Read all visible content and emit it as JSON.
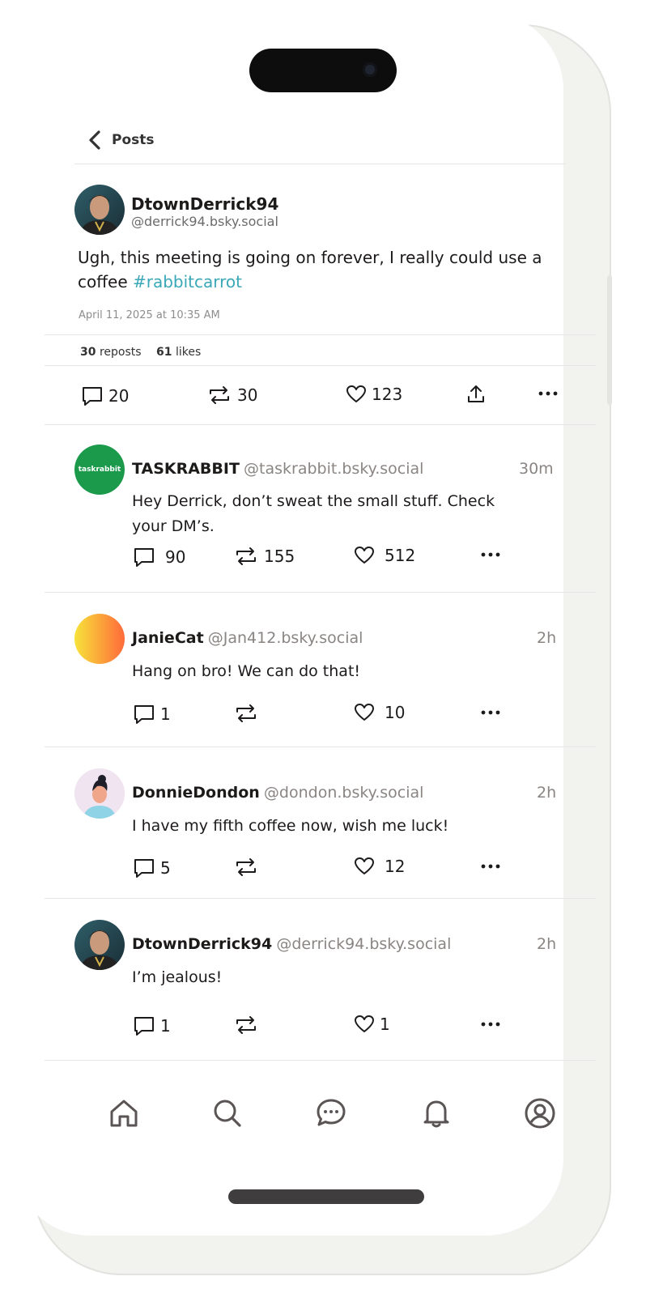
{
  "header": {
    "back_label": "Posts"
  },
  "post": {
    "display_name": "DtownDerrick94",
    "handle": "@derrick94.bsky.social",
    "text": "Ugh, this meeting is going on forever, I really could use a coffee ",
    "hashtag": "#rabbitcarrot",
    "timestamp": "April 11, 2025 at 10:35 AM",
    "reposts_count": "30",
    "reposts_label": "reposts",
    "likes_count": "61",
    "likes_label": "likes",
    "actions": {
      "replies": "20",
      "reposts": "30",
      "likes": "123"
    }
  },
  "replies": [
    {
      "name": "TASKRABBIT",
      "handle": "@taskrabbit.bsky.social",
      "time": "30m",
      "text_line1": "Hey Derrick, don’t sweat the small stuff. Check",
      "text_line2": "your DM’s.",
      "avatar_text": "taskrabbit",
      "replies": "90",
      "reposts": "155",
      "likes": "512"
    },
    {
      "name": "JanieCat",
      "handle": "@Jan412.bsky.social",
      "time": "2h",
      "text": "Hang on bro! We can do that!",
      "replies": "1",
      "reposts": "",
      "likes": "10"
    },
    {
      "name": "DonnieDondon",
      "handle": "@dondon.bsky.social",
      "time": "2h",
      "text": "I have my fifth coffee now, wish me luck!",
      "replies": "5",
      "reposts": "",
      "likes": "12"
    },
    {
      "name": "DtownDerrick94",
      "handle": "@derrick94.bsky.social",
      "time": "2h",
      "text": "I’m jealous!",
      "replies": "1",
      "reposts": "",
      "likes": "1"
    }
  ],
  "tabbar": [
    "home-icon",
    "search-icon",
    "chat-icon",
    "bell-icon",
    "profile-icon"
  ],
  "colors": {
    "hashtag": "#3aa7b7",
    "taskrabbit_green": "#1a9a4a",
    "secondary_text": "#8a8583"
  }
}
